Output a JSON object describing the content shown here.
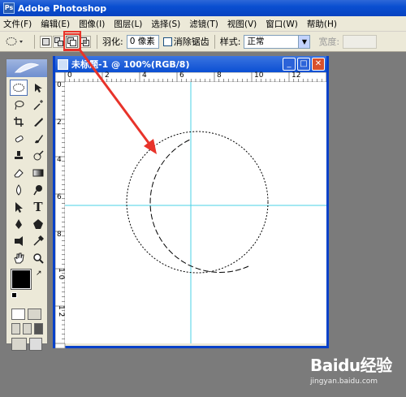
{
  "app": {
    "title": "Adobe Photoshop",
    "icon": "photoshop-icon"
  },
  "menu": [
    {
      "label": "文件(F)"
    },
    {
      "label": "编辑(E)"
    },
    {
      "label": "图像(I)"
    },
    {
      "label": "图层(L)"
    },
    {
      "label": "选择(S)"
    },
    {
      "label": "滤镜(T)"
    },
    {
      "label": "视图(V)"
    },
    {
      "label": "窗口(W)"
    },
    {
      "label": "帮助(H)"
    }
  ],
  "options": {
    "feather_label": "羽化:",
    "feather_value": "0 像素",
    "antialias_label": "消除锯齿",
    "style_label": "样式:",
    "style_value": "正常",
    "width_label": "宽度:",
    "selection_modes": [
      "new-selection",
      "add-to-selection",
      "subtract-from-selection",
      "intersect-selection"
    ],
    "active_mode": "subtract-from-selection"
  },
  "document": {
    "title": "未标题-1 @ 100%(RGB/8)",
    "ruler_h": [
      "0",
      "2",
      "4",
      "6",
      "8",
      "10",
      "12"
    ],
    "ruler_v": [
      "0",
      "2",
      "4",
      "6",
      "8",
      "1 0",
      "1 2"
    ]
  },
  "colors": {
    "accent": "#0841c9",
    "annotation": "#e8332a",
    "guide": "#49d0e6",
    "foreground": "#000000",
    "background": "#9a9a9a"
  },
  "watermark": {
    "brand": "Baidu经验",
    "url": "jingyan.baidu.com"
  }
}
